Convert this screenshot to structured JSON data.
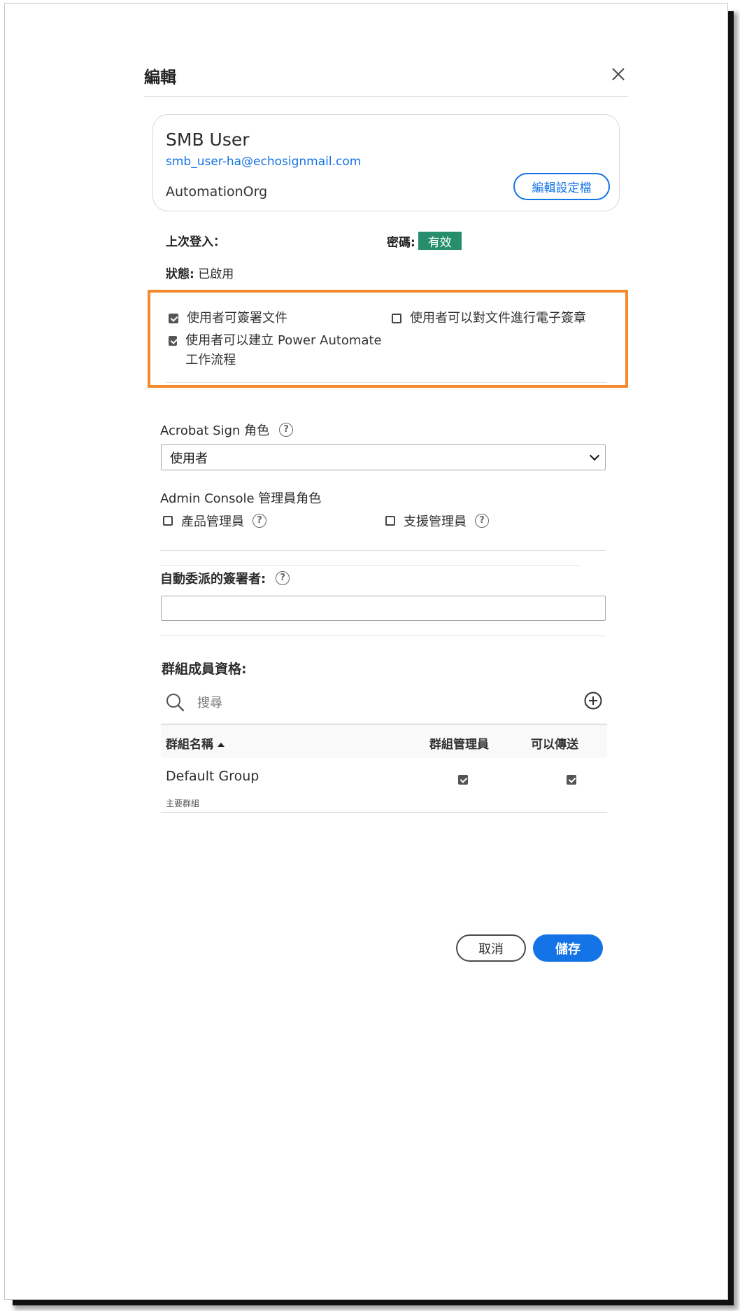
{
  "dialog": {
    "title": "編輯"
  },
  "user": {
    "name": "SMB User",
    "email": "smb_user-ha@echosignmail.com",
    "org": "AutomationOrg",
    "edit_profile_label": "編輯設定檔"
  },
  "info": {
    "last_login_label": "上次登入：",
    "password_label": "密碼:",
    "password_badge": "有效",
    "status_label": "狀態:",
    "status_value": "已啟用"
  },
  "permissions": [
    {
      "label": "使用者可簽署文件",
      "checked": true
    },
    {
      "label": "使用者可以對文件進行電子簽章",
      "checked": false
    },
    {
      "label": "使用者可以建立 Power Automate 工作流程",
      "checked": true
    }
  ],
  "sign_role": {
    "label": "Acrobat Sign 角色",
    "selected": "使用者"
  },
  "admin_console": {
    "label": "Admin Console 管理員角色",
    "options": [
      {
        "label": "產品管理員",
        "checked": false
      },
      {
        "label": "支援管理員",
        "checked": false
      }
    ]
  },
  "delegate": {
    "label": "自動委派的簽署者:",
    "value": ""
  },
  "groups": {
    "label": "群組成員資格:",
    "search_placeholder": "搜尋",
    "columns": {
      "name": "群組名稱",
      "admin": "群組管理員",
      "send": "可以傳送"
    },
    "rows": [
      {
        "name": "Default Group",
        "subtitle": "主要群組",
        "admin": true,
        "send": true
      }
    ]
  },
  "footer": {
    "cancel_label": "取消",
    "save_label": "儲存"
  },
  "colors": {
    "accent": "#1473e6",
    "badge": "#268e6c",
    "highlight": "#f58a2c"
  }
}
